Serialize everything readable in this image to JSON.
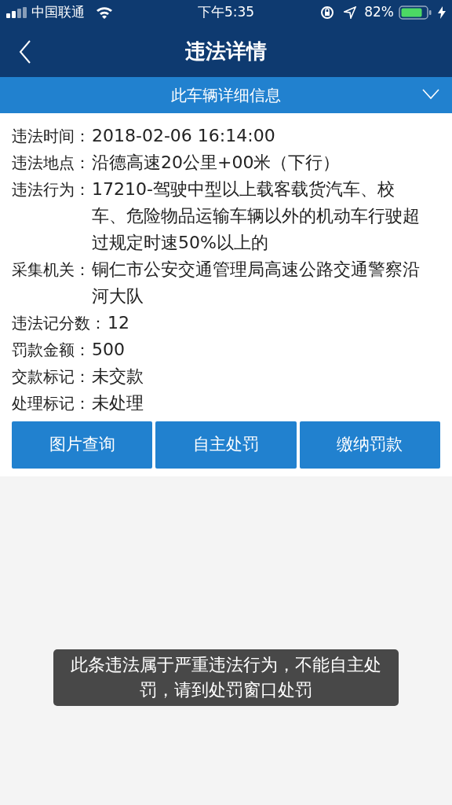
{
  "status_bar": {
    "carrier": "中国联通",
    "time": "下午5:35",
    "battery": "82%"
  },
  "nav": {
    "title": "违法详情"
  },
  "section": {
    "title": "此车辆详细信息",
    "expanded": true
  },
  "details": [
    {
      "label": "违法时间：",
      "value": "2018-02-06 16:14:00"
    },
    {
      "label": "违法地点：",
      "value": "沿德高速20公里+00米（下行）"
    },
    {
      "label": "违法行为：",
      "value": "17210-驾驶中型以上载客载货汽车、校车、危险物品运输车辆以外的机动车行驶超过规定时速50%以上的"
    },
    {
      "label": "采集机关：",
      "value": "铜仁市公安交通管理局高速公路交通警察沿河大队"
    },
    {
      "label": "违法记分数：",
      "value": "12"
    },
    {
      "label": "罚款金额：",
      "value": "500"
    },
    {
      "label": "交款标记：",
      "value": "未交款"
    },
    {
      "label": "处理标记：",
      "value": "未处理"
    }
  ],
  "buttons": [
    "图片查询",
    "自主处罚",
    "缴纳罚款"
  ],
  "toast": "此条违法属于严重违法行为，不能自主处罚，请到处罚窗口处罚"
}
